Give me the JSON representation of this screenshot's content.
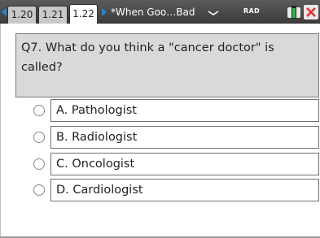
{
  "tabs": [
    {
      "label": "1.20",
      "active": false
    },
    {
      "label": "1.21",
      "active": false
    },
    {
      "label": "1.22",
      "active": true
    }
  ],
  "document": {
    "title": "*When Goo…Bad",
    "dropdown_icon": "chevron-down-icon"
  },
  "status": {
    "mode": "RAD",
    "battery_icon": "battery-icon",
    "close_icon": "close-icon"
  },
  "colors": {
    "accent": "#1f86d6",
    "close": "#e3343a",
    "battery": "#2db34a",
    "question_bg": "#d9d9d9"
  },
  "question": {
    "text": "Q7. What do you think a \"cancer doctor\" is called?"
  },
  "choices": [
    {
      "label": "A. Pathologist"
    },
    {
      "label": "B. Radiologist"
    },
    {
      "label": "C. Oncologist"
    },
    {
      "label": "D. Cardiologist"
    }
  ]
}
